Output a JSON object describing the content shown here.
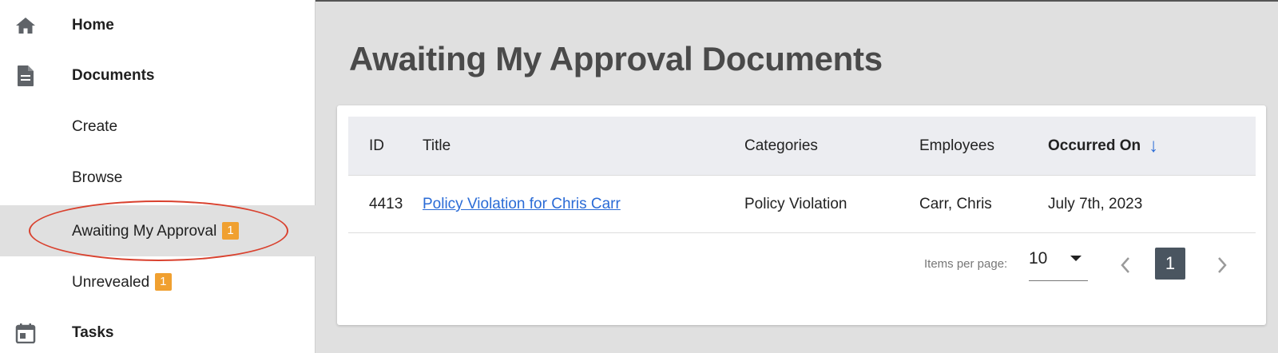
{
  "sidebar": {
    "items": [
      {
        "label": "Home",
        "icon": "home-icon"
      },
      {
        "label": "Documents",
        "icon": "document-icon"
      },
      {
        "label": "Create"
      },
      {
        "label": "Browse"
      },
      {
        "label": "Awaiting My Approval",
        "badge": "1",
        "active": true
      },
      {
        "label": "Unrevealed",
        "badge": "1"
      },
      {
        "label": "Tasks",
        "icon": "calendar-icon"
      }
    ]
  },
  "main": {
    "title": "Awaiting My Approval Documents",
    "table": {
      "columns": [
        "ID",
        "Title",
        "Categories",
        "Employees",
        "Occurred On"
      ],
      "sorted_column": "Occurred On",
      "sort_direction": "descending",
      "rows": [
        {
          "id": "4413",
          "title": "Policy Violation for Chris Carr",
          "categories": "Policy Violation",
          "employees": "Carr, Chris",
          "occurred_on": "July 7th, 2023"
        }
      ]
    },
    "pagination": {
      "items_per_page_label": "Items per page:",
      "items_per_page": "10",
      "current_page": "1"
    }
  },
  "colors": {
    "badge": "#f0a030",
    "link": "#2a6bd6",
    "highlight": "#d9412e",
    "active_page": "#4a5560"
  }
}
